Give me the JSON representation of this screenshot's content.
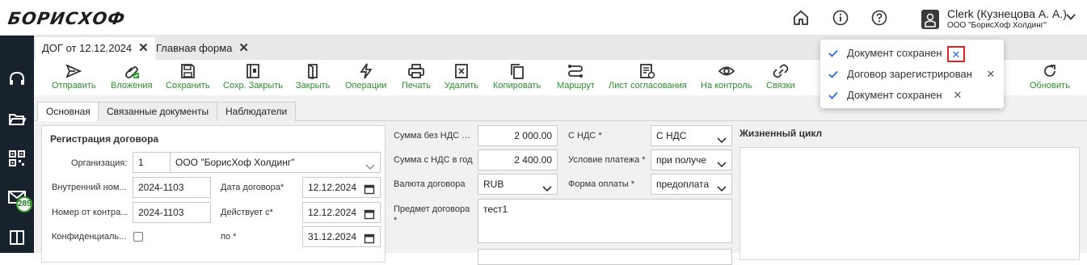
{
  "app": {
    "logo": "БОРИСХОФ"
  },
  "header": {
    "icons": [
      "home-icon",
      "info-icon",
      "help-icon"
    ],
    "user_name": "Clerk (Кузнецова А. А.)",
    "user_org": "ООО \"БорисХоф Холдинг\""
  },
  "sidebar": {
    "badge": "285",
    "icons": [
      "headset-icon",
      "folder-icon",
      "qr-icon",
      "mail-icon",
      "book-icon"
    ]
  },
  "tabs": [
    {
      "label": "ДОГ от 12.12.2024"
    },
    {
      "label": "Главная форма"
    }
  ],
  "toolbar": {
    "items": [
      {
        "label": "Отправить",
        "icon": "send-icon"
      },
      {
        "label": "Вложения",
        "icon": "attachment-icon"
      },
      {
        "label": "Сохранить",
        "icon": "save-icon"
      },
      {
        "label": "Сохр. Закрыть",
        "icon": "save-close-icon"
      },
      {
        "label": "Закрыть",
        "icon": "close-doc-icon"
      },
      {
        "label": "Операции",
        "icon": "lightning-icon"
      },
      {
        "label": "Печать",
        "icon": "print-icon"
      },
      {
        "label": "Удалить",
        "icon": "delete-icon"
      },
      {
        "label": "Копировать",
        "icon": "copy-icon"
      },
      {
        "label": "Маршрут",
        "icon": "route-icon"
      },
      {
        "label": "Лист согласования",
        "icon": "approval-sheet-icon"
      },
      {
        "label": "На контроль",
        "icon": "eye-icon"
      },
      {
        "label": "Связки",
        "icon": "link-icon"
      },
      {
        "label": "Обновить",
        "icon": "refresh-icon"
      }
    ],
    "accent": "#2e8b2e"
  },
  "form_tabs": [
    {
      "label": "Основная"
    },
    {
      "label": "Связанные документы"
    },
    {
      "label": "Наблюдатели"
    }
  ],
  "registration": {
    "title": "Регистрация договора",
    "org_label": "Организация:",
    "org_code": "1",
    "org_name": "ООО \"БорисХоф Холдинг\"",
    "internal_no_label": "Внутренний ном...",
    "internal_no": "2024-1103",
    "contract_date_label": "Дата договора*",
    "contract_date": "12.12.2024",
    "counterparty_no_label": "Номер от контра...",
    "counterparty_no": "2024-1103",
    "valid_from_label": "Действует с*",
    "valid_from": "12.12.2024",
    "confidential_label": "Конфиденциаль...",
    "valid_to_label": "по *",
    "valid_to": "31.12.2024"
  },
  "finance": {
    "sum_no_vat_label": "Сумма без НДС в ...",
    "sum_no_vat": "2 000.00",
    "with_vat_label": "С НДС *",
    "with_vat": "С НДС",
    "sum_vat_year_label": "Сумма с НДС в год",
    "sum_vat_year": "2 400.00",
    "payment_cond_label": "Условие платежа *",
    "payment_cond": "при получе",
    "currency_label": "Валюта договора",
    "currency": "RUB",
    "payment_form_label": "Форма оплаты *",
    "payment_form": "предоплата",
    "subject_label": "Предмет договора",
    "subject_star": "*",
    "subject": "тест1"
  },
  "lifecycle": {
    "title": "Жизненный цикл"
  },
  "notifications": [
    {
      "text": "Документ сохранен"
    },
    {
      "text": "Договор зарегистрирован"
    },
    {
      "text": "Документ сохранен"
    }
  ]
}
